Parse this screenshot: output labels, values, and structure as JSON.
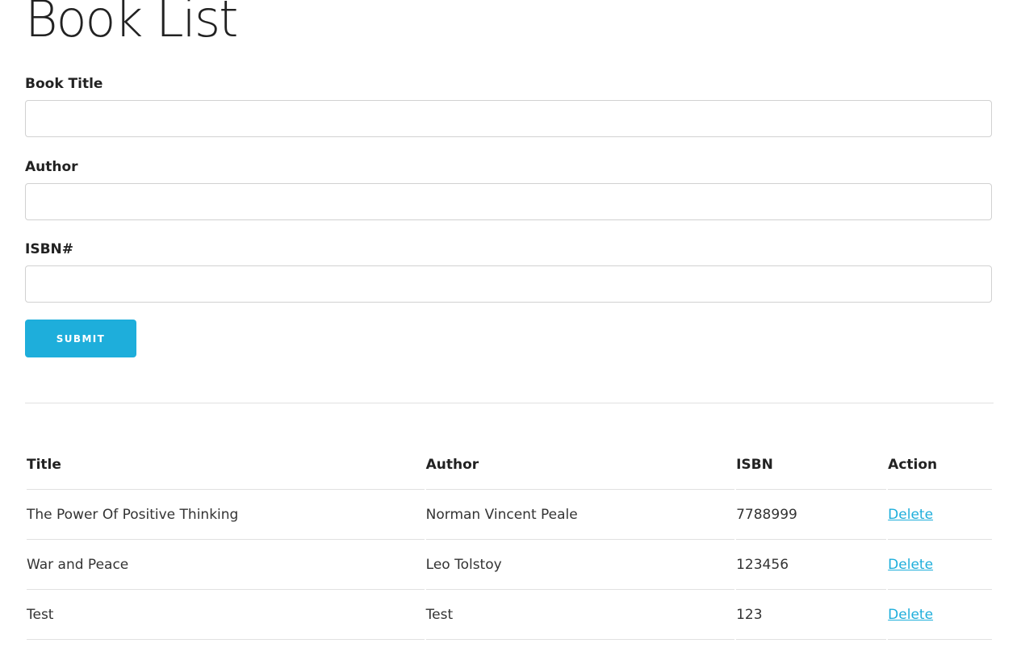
{
  "page": {
    "title": "Book List"
  },
  "form": {
    "book_title_label": "Book Title",
    "book_title_value": "",
    "author_label": "Author",
    "author_value": "",
    "isbn_label": "ISBN#",
    "isbn_value": "",
    "submit_label": "SUBMIT"
  },
  "table": {
    "headers": [
      "Title",
      "Author",
      "ISBN",
      "Action"
    ],
    "rows": [
      {
        "title": "The Power Of Positive Thinking",
        "author": "Norman Vincent Peale",
        "isbn": "7788999",
        "action": "Delete"
      },
      {
        "title": "War and Peace",
        "author": "Leo Tolstoy",
        "isbn": "123456",
        "action": "Delete"
      },
      {
        "title": "Test",
        "author": "Test",
        "isbn": "123",
        "action": "Delete"
      }
    ]
  },
  "colors": {
    "accent": "#1eaedb",
    "text": "#222222",
    "border": "#d1d1d1",
    "divider": "#e1e1e1"
  }
}
